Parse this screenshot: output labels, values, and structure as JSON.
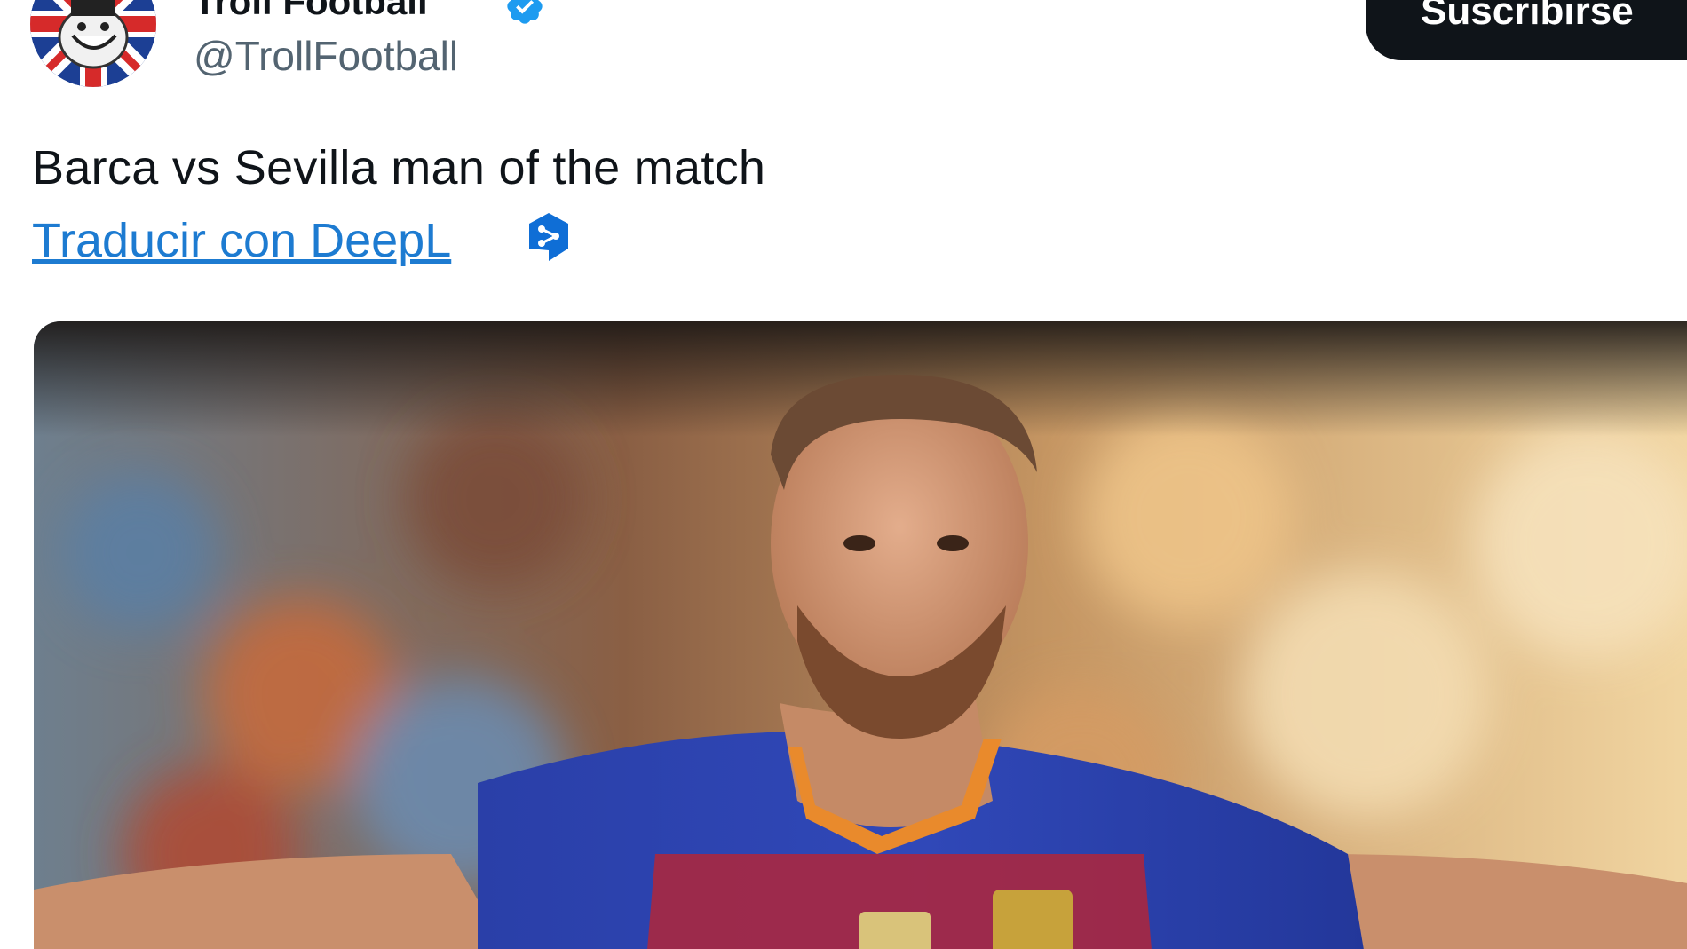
{
  "tweet": {
    "display_name": "Troll Football",
    "handle": "@TrollFootball",
    "subscribe_label": "Suscribirse",
    "text": "Barca vs Sevilla man of the match",
    "translate_label": "Traducir con DeepL "
  },
  "icons": {
    "avatar": "troll-face-union-jack-avatar",
    "verified": "verified-badge-icon",
    "deepl": "deepl-icon"
  },
  "colors": {
    "text": "#0f1419",
    "secondary_text": "#536471",
    "link": "#1d7bd1",
    "verified": "#1d9bf0",
    "button_bg": "#0f1419"
  }
}
